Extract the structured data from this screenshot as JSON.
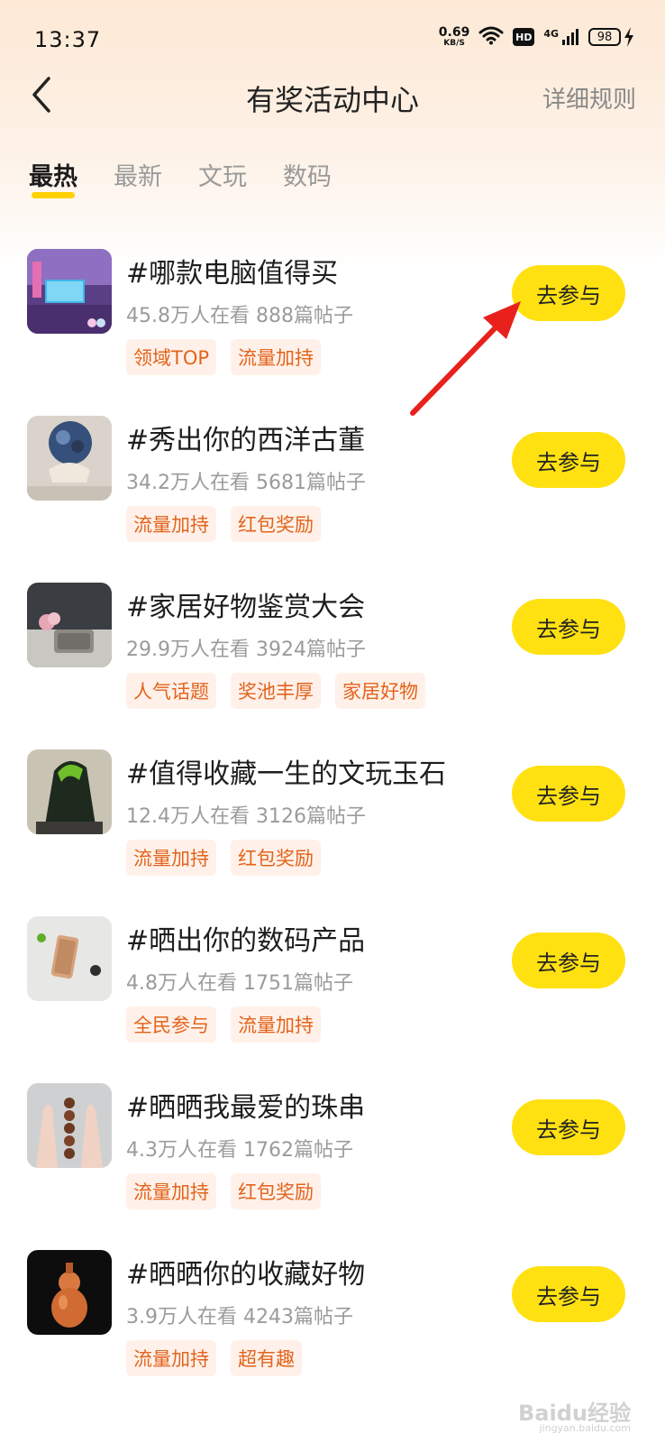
{
  "status_bar": {
    "time": "13:37",
    "net_speed": "0.69",
    "net_unit": "KB/S",
    "hd": "HD",
    "network": "4G",
    "battery": "98"
  },
  "header": {
    "title": "有奖活动中心",
    "rules_label": "详细规则"
  },
  "tabs": [
    {
      "label": "最热",
      "active": true
    },
    {
      "label": "最新",
      "active": false
    },
    {
      "label": "文玩",
      "active": false
    },
    {
      "label": "数码",
      "active": false
    }
  ],
  "topics": [
    {
      "title": "#哪款电脑值得买",
      "meta": "45.8万人在看 888篇帖子",
      "tags": [
        "领域TOP",
        "流量加持"
      ],
      "button": "去参与"
    },
    {
      "title": "#秀出你的西洋古董",
      "meta": "34.2万人在看 5681篇帖子",
      "tags": [
        "流量加持",
        "红包奖励"
      ],
      "button": "去参与"
    },
    {
      "title": "#家居好物鉴赏大会",
      "meta": "29.9万人在看 3924篇帖子",
      "tags": [
        "人气话题",
        "奖池丰厚",
        "家居好物"
      ],
      "button": "去参与"
    },
    {
      "title": "#值得收藏一生的文玩玉石",
      "meta": "12.4万人在看 3126篇帖子",
      "tags": [
        "流量加持",
        "红包奖励"
      ],
      "button": "去参与"
    },
    {
      "title": "#晒出你的数码产品",
      "meta": "4.8万人在看 1751篇帖子",
      "tags": [
        "全民参与",
        "流量加持"
      ],
      "button": "去参与"
    },
    {
      "title": "#晒晒我最爱的珠串",
      "meta": "4.3万人在看 1762篇帖子",
      "tags": [
        "流量加持",
        "红包奖励"
      ],
      "button": "去参与"
    },
    {
      "title": "#晒晒你的收藏好物",
      "meta": "3.9万人在看 4243篇帖子",
      "tags": [
        "流量加持",
        "超有趣"
      ],
      "button": "去参与"
    }
  ],
  "watermark": {
    "text": "Baidu经验",
    "sub": "jingyan.baidu.com"
  },
  "colors": {
    "accent": "#ffe112",
    "tag_text": "#e3631c",
    "tag_bg": "#fff1e9",
    "annotation": "#e8211d"
  }
}
